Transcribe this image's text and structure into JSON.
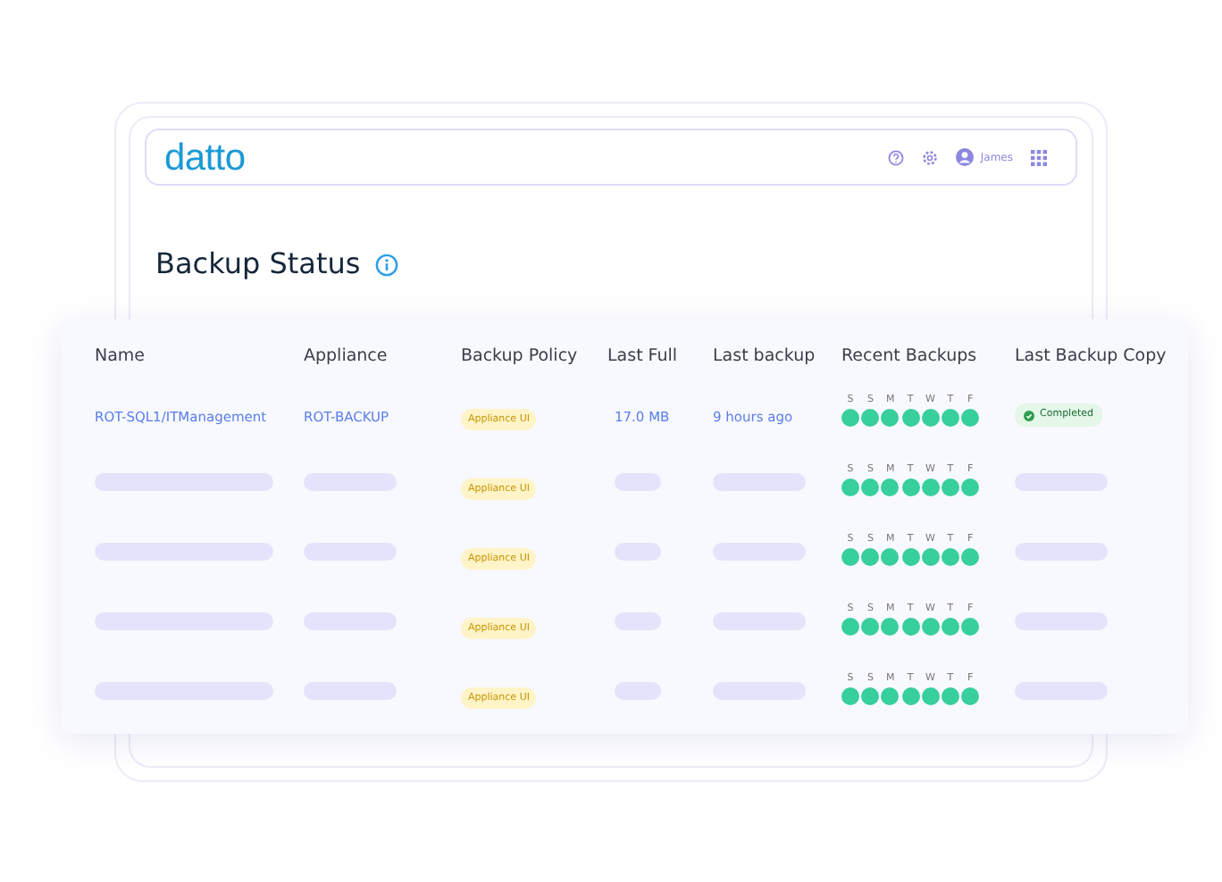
{
  "header": {
    "logo": "datto",
    "user": "James"
  },
  "page": {
    "title": "Backup Status"
  },
  "table": {
    "columns": [
      "Name",
      "Appliance",
      "Backup Policy",
      "Last Full",
      "Last backup",
      "Recent Backups",
      "Last Backup Copy"
    ],
    "rows": [
      {
        "kind": "filled",
        "name": "ROT-SQL1/ITManagement",
        "appliance": "ROT-BACKUP",
        "policy": "Appliance UI",
        "last_full": "17.0 MB",
        "last_backup": "9 hours ago",
        "days": [
          {
            "label": "S",
            "succeeded": true
          },
          {
            "label": "S",
            "succeeded": true
          },
          {
            "label": "M",
            "succeeded": true
          },
          {
            "label": "T",
            "succeeded": true
          },
          {
            "label": "W",
            "succeeded": true
          },
          {
            "label": "T",
            "succeeded": true
          },
          {
            "label": "F",
            "succeeded": true
          }
        ],
        "copy_status": "Completed"
      },
      {
        "kind": "placeholder",
        "policy": "Appliance UI",
        "days": [
          {
            "label": "S",
            "succeeded": true
          },
          {
            "label": "S",
            "succeeded": true
          },
          {
            "label": "M",
            "succeeded": true
          },
          {
            "label": "T",
            "succeeded": true
          },
          {
            "label": "W",
            "succeeded": true
          },
          {
            "label": "T",
            "succeeded": true
          },
          {
            "label": "F",
            "succeeded": true
          }
        ]
      },
      {
        "kind": "placeholder",
        "policy": "Appliance UI",
        "days": [
          {
            "label": "S",
            "succeeded": true
          },
          {
            "label": "S",
            "succeeded": true
          },
          {
            "label": "M",
            "succeeded": true
          },
          {
            "label": "T",
            "succeeded": true
          },
          {
            "label": "W",
            "succeeded": true
          },
          {
            "label": "T",
            "succeeded": true
          },
          {
            "label": "F",
            "succeeded": true
          }
        ]
      },
      {
        "kind": "placeholder",
        "policy": "Appliance UI",
        "days": [
          {
            "label": "S",
            "succeeded": true
          },
          {
            "label": "S",
            "succeeded": true
          },
          {
            "label": "M",
            "succeeded": true
          },
          {
            "label": "T",
            "succeeded": true
          },
          {
            "label": "W",
            "succeeded": true
          },
          {
            "label": "T",
            "succeeded": true
          },
          {
            "label": "F",
            "succeeded": true
          }
        ]
      },
      {
        "kind": "placeholder",
        "policy": "Appliance UI",
        "days": [
          {
            "label": "S",
            "succeeded": true
          },
          {
            "label": "S",
            "succeeded": true
          },
          {
            "label": "M",
            "succeeded": true
          },
          {
            "label": "T",
            "succeeded": true
          },
          {
            "label": "W",
            "succeeded": true
          },
          {
            "label": "T",
            "succeeded": true
          },
          {
            "label": "F",
            "succeeded": true
          }
        ]
      }
    ]
  }
}
